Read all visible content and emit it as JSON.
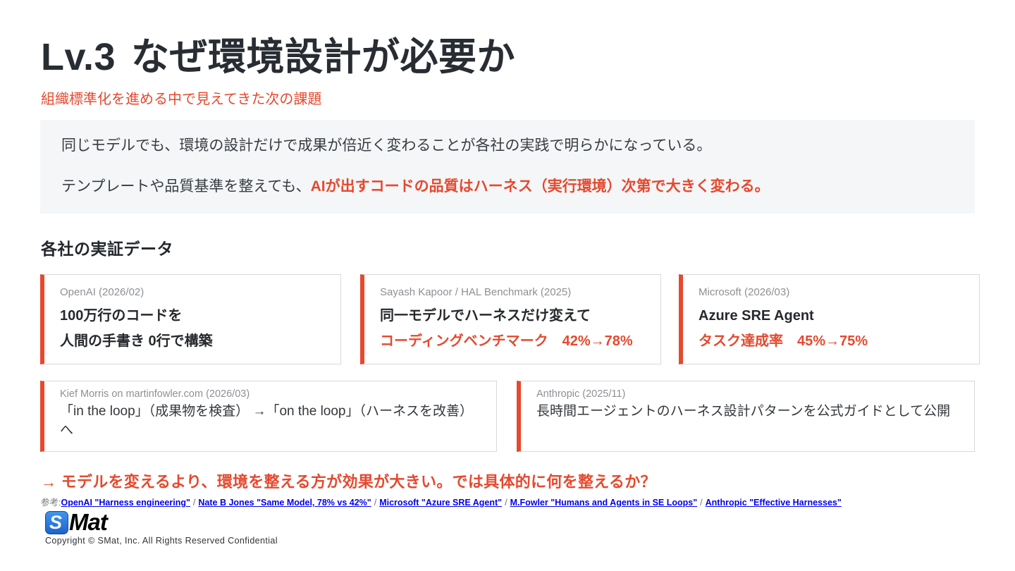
{
  "colors": {
    "accent": "#e5492e",
    "link": "#0000ee",
    "box_bg": "#f4f6f8",
    "card_border": "#d9d9d9"
  },
  "header": {
    "level": "Lv.3",
    "title": "なぜ環境設計が必要か",
    "subtitle": "組織標準化を進める中で見えてきた次の課題"
  },
  "summary": {
    "line1": "同じモデルでも、環境の設計だけで成果が倍近く変わることが各社の実践で明らかになっている。",
    "line2_prefix": "テンプレートや品質基準を整えても、",
    "line2_highlight": "AIが出すコードの品質はハーネス（実行環境）次第で大きく変わる。"
  },
  "evidence": {
    "heading": "各社の実証データ",
    "row1": [
      {
        "source": "OpenAI (2026/02)",
        "line1": "100万行のコードを",
        "line2": "人間の手書き 0行で構築"
      },
      {
        "source": "Sayash Kapoor / HAL Benchmark (2025)",
        "line1": "同一モデルでハーネスだけ変えて",
        "line2": "コーディングベンチマーク　42%→78%"
      },
      {
        "source": "Microsoft (2026/03)",
        "line1": "Azure SRE Agent",
        "line2": "タスク達成率　45%→75%"
      }
    ],
    "row2": [
      {
        "source": "Kief Morris on martinfowler.com (2026/03)",
        "text": "「in the loop」（成果物を検査） →「on the loop」（ハーネスを改善）へ"
      },
      {
        "source": "Anthropic (2025/11)",
        "text": "長時間エージェントのハーネス設計パターンを公式ガイドとして公開"
      }
    ]
  },
  "conclusion": "→ モデルを変えるより、環境を整える方が効果が大きい。では具体的に何を整えるか？",
  "references": {
    "label": "参考:",
    "separator": "/",
    "links": [
      "OpenAI \"Harness engineering\"",
      "Nate B Jones \"Same Model, 78% vs 42%\"",
      "Microsoft \"Azure SRE Agent\"",
      "M.Fowler \"Humans and Agents in SE Loops\"",
      "Anthropic \"Effective Harnesses\""
    ]
  },
  "footer": {
    "logo_s": "S",
    "logo_rest": "Mat",
    "copyright": "Copyright © SMat, Inc. All Rights Reserved Confidential"
  }
}
